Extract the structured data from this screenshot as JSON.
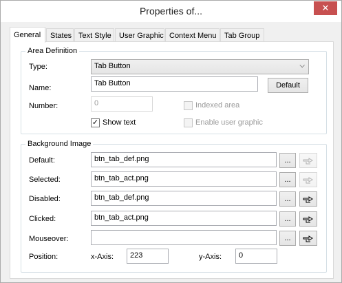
{
  "window": {
    "title": "Properties of...",
    "close_glyph": "✕"
  },
  "tabs": [
    "General",
    "States",
    "Text Style",
    "User Graphic",
    "Context Menu",
    "Tab Group"
  ],
  "area": {
    "legend": "Area Definition",
    "type_label": "Type:",
    "type_value": "Tab Button",
    "name_label": "Name:",
    "name_value": "Tab Button",
    "default_button": "Default",
    "number_label": "Number:",
    "number_value": "0",
    "indexed_area": "Indexed area",
    "show_text": "Show text",
    "enable_user_graphic": "Enable user graphic"
  },
  "background": {
    "legend": "Background Image",
    "rows": [
      {
        "label": "Default:",
        "value": "btn_tab_def.png",
        "browse": "...",
        "icon_enabled": false
      },
      {
        "label": "Selected:",
        "value": "btn_tab_act.png",
        "browse": "...",
        "icon_enabled": false
      },
      {
        "label": "Disabled:",
        "value": "btn_tab_def.png",
        "browse": "...",
        "icon_enabled": true
      },
      {
        "label": "Clicked:",
        "value": "btn_tab_act.png",
        "browse": "...",
        "icon_enabled": true
      },
      {
        "label": "Mouseover:",
        "value": "",
        "browse": "...",
        "icon_enabled": true
      }
    ],
    "position_label": "Position:",
    "x_label": "x-Axis:",
    "x_value": "223",
    "y_label": "y-Axis:",
    "y_value": "0"
  },
  "colors": {
    "close_bg": "#c75050",
    "group_border": "#d5dfe5"
  }
}
